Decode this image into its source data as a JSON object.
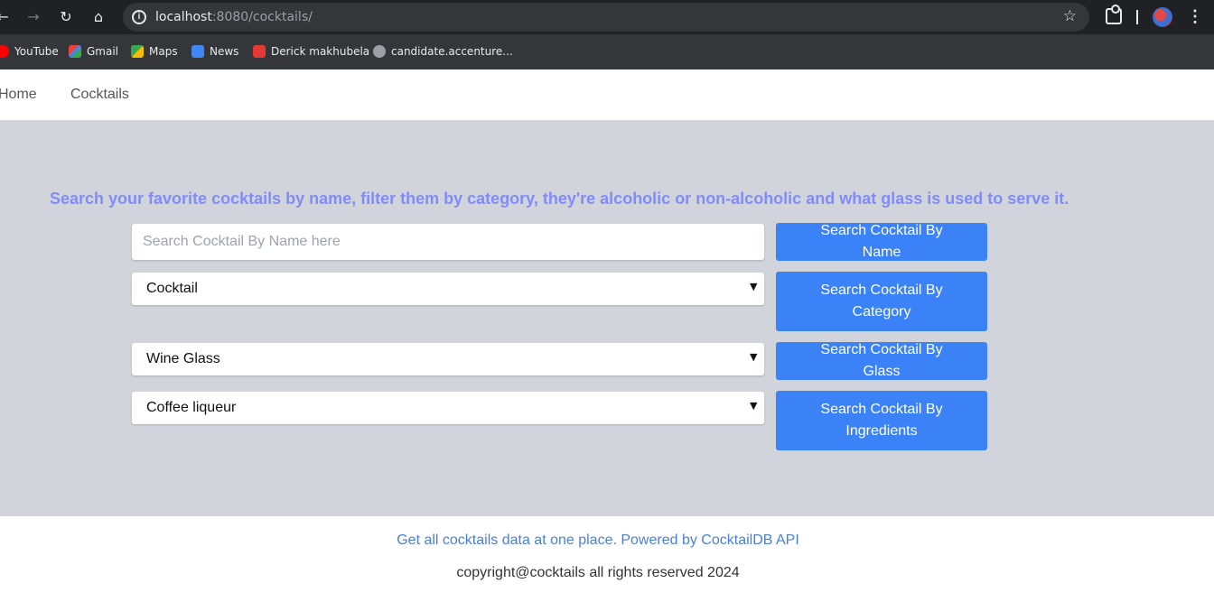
{
  "browser": {
    "url_host": "localhost",
    "url_path": ":8080/cocktails/",
    "bookmarks": [
      {
        "label": "YouTube",
        "icon": "youtube-icon",
        "color": "#ff0000"
      },
      {
        "label": "Gmail",
        "icon": "gmail-icon",
        "color": "#ea4335"
      },
      {
        "label": "Maps",
        "icon": "maps-icon",
        "color": "#34a853"
      },
      {
        "label": "News",
        "icon": "news-icon",
        "color": "#4285f4"
      },
      {
        "label": "Derick makhubela",
        "icon": "profile-icon",
        "color": "#e53935"
      },
      {
        "label": "candidate.accenture...",
        "icon": "globe-icon",
        "color": "#9aa0a6"
      }
    ]
  },
  "nav": {
    "home": "Home",
    "cocktails": "Cocktails"
  },
  "hero": {
    "tagline": "Search your favorite cocktails by name, filter them by category, they're alcoholic or non-alcoholic and what glass is used to serve it.",
    "name_input_placeholder": "Search Cocktail By Name here",
    "name_button": "Search Cocktail By Name",
    "category_selected": "Cocktail",
    "category_button": "Search Cocktail By Category",
    "glass_selected": "Wine Glass",
    "glass_button": "Search Cocktail By Glass",
    "ingredient_selected": "Coffee liqueur",
    "ingredient_button": "Search Cocktail By Ingredients"
  },
  "footer": {
    "link": "Get all cocktails data at one place. Powered by CocktailDB API",
    "copyright": "copyright@cocktails all rights reserved 2024"
  },
  "colors": {
    "hero_bg": "#d1d5db",
    "tagline": "#818cf8",
    "button": "#3b82f6",
    "footer_link": "#4a7fd8"
  }
}
